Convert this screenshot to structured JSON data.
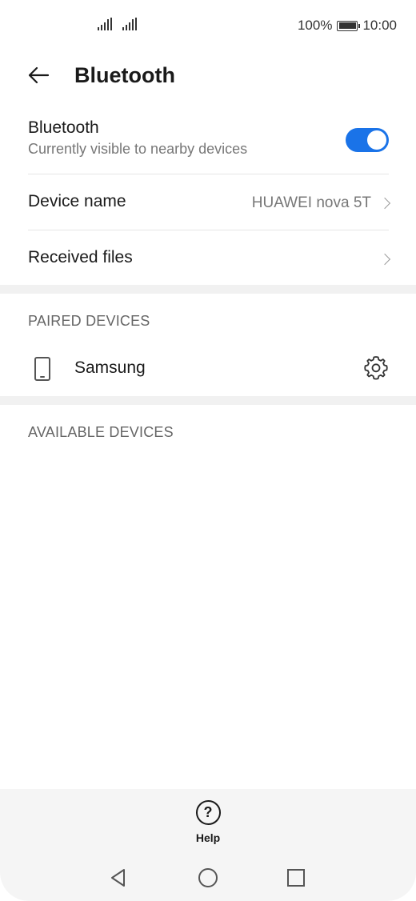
{
  "status_bar": {
    "battery_percent": "100%",
    "time": "10:00",
    "battery_level": 1.0
  },
  "header": {
    "title": "Bluetooth",
    "back_icon": "arrow-left-icon"
  },
  "bluetooth_toggle": {
    "label": "Bluetooth",
    "subtitle": "Currently visible to nearby devices",
    "state": "on",
    "accent_color": "#1a73e8"
  },
  "device_name": {
    "label": "Device name",
    "value": "HUAWEI nova 5T"
  },
  "received_files": {
    "label": "Received files"
  },
  "paired_devices": {
    "header": "PAIRED DEVICES",
    "items": [
      {
        "name": "Samsung",
        "icon": "phone-icon",
        "settings_icon": "gear-icon"
      }
    ]
  },
  "available_devices": {
    "header": "AVAILABLE DEVICES",
    "items": []
  },
  "bottom": {
    "help_label": "Help",
    "help_icon": "question-mark-icon"
  },
  "nav": {
    "back_icon": "triangle-back-icon",
    "home_icon": "circle-home-icon",
    "recents_icon": "square-recents-icon"
  }
}
